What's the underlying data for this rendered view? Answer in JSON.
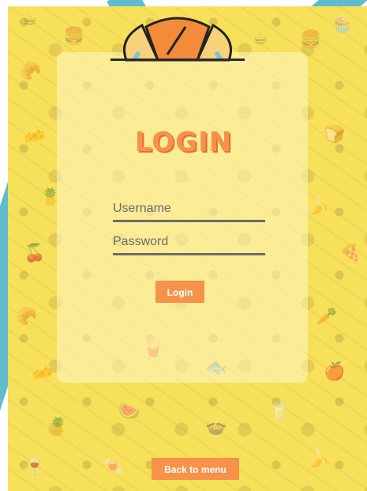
{
  "login": {
    "title": "LOGIN",
    "username_placeholder": "Username",
    "password_placeholder": "Password",
    "submit_label": "Login"
  },
  "footer": {
    "back_label": "Back to menu"
  },
  "colors": {
    "accent": "#f6924a",
    "panel": "#f7e05a",
    "teal": "#5fbccd"
  },
  "decor": {
    "logo_icon": "croissant-icon",
    "pattern_icons": [
      "cupcake-icon",
      "pineapple-icon",
      "banana-icon",
      "fish-icon",
      "bottle-icon",
      "cheese-icon",
      "pizza-slice-icon",
      "wheat-icon"
    ]
  }
}
